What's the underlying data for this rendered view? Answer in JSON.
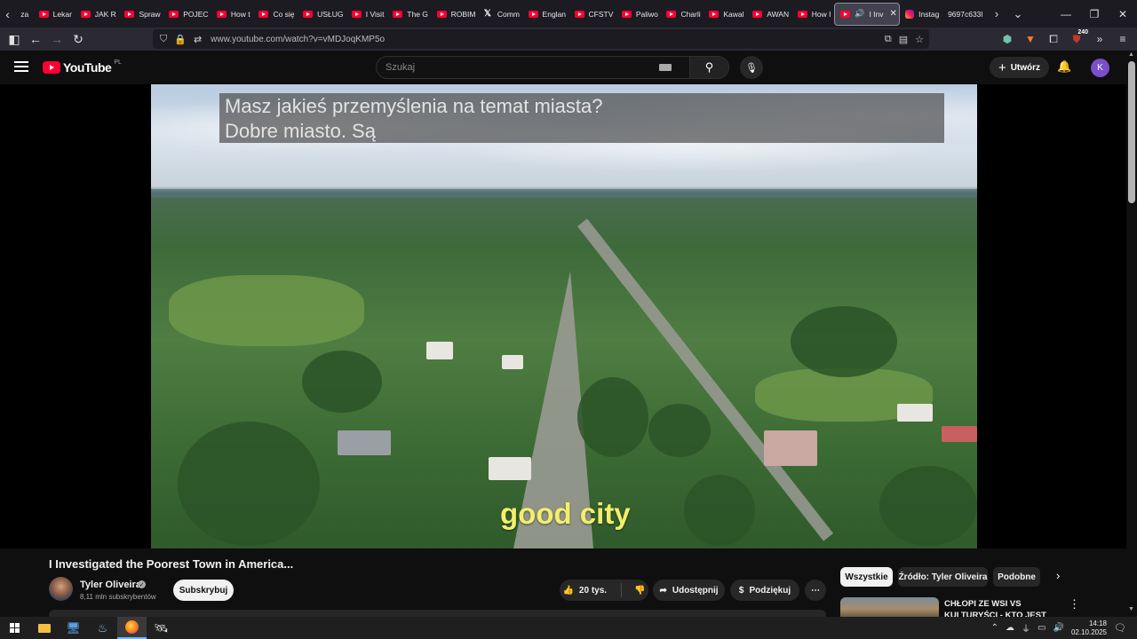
{
  "browser": {
    "tabs": [
      {
        "label": "za",
        "icon": "none"
      },
      {
        "label": "Lekar",
        "icon": "youtube-icon"
      },
      {
        "label": "JAK R",
        "icon": "youtube-icon"
      },
      {
        "label": "Spraw",
        "icon": "youtube-icon"
      },
      {
        "label": "POJEC",
        "icon": "youtube-icon"
      },
      {
        "label": "How t",
        "icon": "youtube-icon"
      },
      {
        "label": "Co się",
        "icon": "youtube-icon"
      },
      {
        "label": "USŁUG",
        "icon": "youtube-icon"
      },
      {
        "label": "I Visit",
        "icon": "youtube-icon"
      },
      {
        "label": "The G",
        "icon": "youtube-icon"
      },
      {
        "label": "ROBIM",
        "icon": "youtube-icon"
      },
      {
        "label": "Comm",
        "icon": "x-icon"
      },
      {
        "label": "Englan",
        "icon": "youtube-icon"
      },
      {
        "label": "CFSTV",
        "icon": "youtube-icon"
      },
      {
        "label": "Paliwo",
        "icon": "youtube-icon"
      },
      {
        "label": "Charli",
        "icon": "youtube-icon"
      },
      {
        "label": "Kawal",
        "icon": "youtube-icon"
      },
      {
        "label": "AWAN",
        "icon": "youtube-icon"
      },
      {
        "label": "How I",
        "icon": "youtube-icon"
      },
      {
        "label": "I Inv",
        "icon": "youtube-icon",
        "active": true
      },
      {
        "label": "Instag",
        "icon": "instagram-icon"
      },
      {
        "label": "9697c633l",
        "icon": "none"
      }
    ],
    "url": "www.youtube.com/watch?v=vMDJoqKMP5o",
    "extension_badge": "240"
  },
  "youtube": {
    "logo_text": "YouTube",
    "country_code": "PL",
    "search_placeholder": "Szukaj",
    "create_label": "Utwórz",
    "avatar_letter": "K",
    "colors": {
      "brand_red": "#ff0033",
      "avatar_purple": "#7a4fc9",
      "subtitle_yellow": "#f3ef6a"
    }
  },
  "player": {
    "caption_line1": "Masz jakieś przemyślenia na temat miasta?",
    "caption_line2": "Dobre miasto.   Są",
    "burned_subtitle": "good city"
  },
  "video": {
    "title": "I Investigated the Poorest Town in America...",
    "channel_name": "Tyler Oliveira",
    "subscribers": "8,11 mln subskrybentów",
    "subscribe_label": "Subskrybuj",
    "likes": "20 tys.",
    "share_label": "Udostępnij",
    "thanks_label": "Podziękuj"
  },
  "sidebar": {
    "chips": [
      "Wszystkie",
      "Źródło: Tyler Oliveira",
      "Podobne"
    ],
    "rec_title": "CHŁOPI ZE WSI VS KULTURYŚCI - KTO JEST"
  },
  "taskbar": {
    "time": "14:18",
    "date": "02.10.2025"
  }
}
